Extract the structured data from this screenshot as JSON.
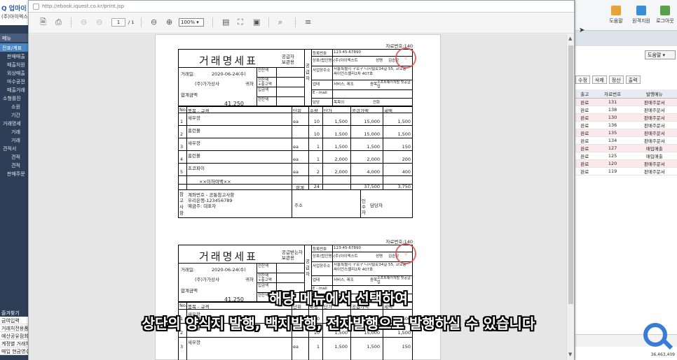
{
  "left_app": {
    "logo": "Q 업마이",
    "company": "(주)아이엑스트",
    "menu_header": "메뉴",
    "section": "전표/계표",
    "items": [
      "판매매출",
      "매출처원",
      "외상매출",
      "마수공전",
      "매출거래",
      "소형를진",
      "소원",
      "기간",
      "거래명세",
      "거래",
      "거래",
      "견적서",
      "견적",
      "견적",
      "판매주문"
    ],
    "bottom_header": "즐겨찾기",
    "bottom_items": [
      "금여입력",
      "거래처전용품목",
      "예산공유점회 설",
      "계정별 거래처",
      "매입 현금영수증"
    ]
  },
  "right_app": {
    "toolbar": [
      {
        "label": "도움말",
        "color": "#e8a23a"
      },
      {
        "label": "원격지원",
        "color": "#3a8ed8"
      },
      {
        "label": "로그아웃",
        "color": "#5aa04a"
      }
    ],
    "help_label": "도움말",
    "actions": [
      "수정",
      "삭제",
      "정산",
      "출력"
    ],
    "columns": [
      "출고",
      "자료번호",
      "발행메뉴"
    ],
    "rows": [
      [
        "완료",
        "131",
        "판매주문서"
      ],
      [
        "완료",
        "138",
        "판매주문서"
      ],
      [
        "완료",
        "130",
        "판매주문서"
      ],
      [
        "완료",
        "136",
        "판매주문서"
      ],
      [
        "완료",
        "135",
        "판매주문서"
      ],
      [
        "완료",
        "134",
        "판매주문서"
      ],
      [
        "완료",
        "127",
        "매입매출"
      ],
      [
        "완료",
        "125",
        "매입매출"
      ],
      [
        "완료",
        "120",
        "판매주문서"
      ],
      [
        "완료",
        "119",
        "판매주문서"
      ]
    ],
    "total": "36,463,409"
  },
  "popup": {
    "url": "http://ebook.iquest.co.kr/print.jsp",
    "page_current": "1",
    "page_total": "/ 1",
    "zoom": "100%"
  },
  "invoice": {
    "doc_no": "자료번호:140",
    "title": "거래명세표",
    "copy_type_1": "공급자",
    "copy_type_2": "보관용",
    "copy_type_b1": "공급받는자",
    "copy_type_b2": "보관용",
    "date_label": "거래일:",
    "date": "2020-06-24(수)",
    "customer": "(주)가가상사",
    "honorific": "귀하",
    "total_label": "합계금액",
    "total_value": "41,250",
    "left_col_labels": [
      "전잔액",
      "전잔액\n+출고액",
      "입금액",
      "현잔액"
    ],
    "supplier_side": "공급자",
    "reg_no_label": "등록번호",
    "reg_no": "123-45-67890",
    "company_label": "상호(법인명)",
    "company_name": "(주)아이엑스트",
    "ceo_label": "성명",
    "ceo_name": "김승모",
    "addr_label": "사업장주소",
    "address": "서울특별시 구로구 디지털로34길 55, 코오롱싸이언스밸리2차 407호",
    "type_label": "업태",
    "type_value": "서비스, 제조",
    "item_label": "종목",
    "item_value": "소프트웨어개발 및공급업",
    "email_label": "E - mail",
    "manager_label": "담당",
    "manager_value": "목목이",
    "phone_label": "전화",
    "seal_text": "인",
    "table_headers": [
      "No.",
      "품목 - 규격",
      "단위",
      "수량",
      "단가",
      "공급가액",
      "세액"
    ],
    "lines": [
      {
        "no": "1",
        "item": "새우깡",
        "unit": "ea",
        "qty": "10",
        "price": "1,500",
        "amount": "15,000",
        "tax": "1,500"
      },
      {
        "no": "2",
        "item": "홈런볼",
        "unit": "",
        "qty": "10",
        "price": "1,500",
        "amount": "15,000",
        "tax": "1,500"
      },
      {
        "no": "3",
        "item": "새우깡",
        "unit": "ea",
        "qty": "1",
        "price": "1,500",
        "amount": "1,500",
        "tax": "150"
      },
      {
        "no": "4",
        "item": "홈런볼",
        "unit": "ea",
        "qty": "1",
        "price": "2,000",
        "amount": "2,000",
        "tax": "200"
      },
      {
        "no": "5",
        "item": "초코파이",
        "unit": "ea",
        "qty": "2",
        "price": "2,000",
        "amount": "4,000",
        "tax": "400"
      }
    ],
    "below_marker": "××이하여백××",
    "sum_label": "합계",
    "sum_qty": "24",
    "sum_amount": "37,500",
    "sum_tax": "3,750",
    "notes_side": "참고사항",
    "notes": [
      "계좌번호 - 공통참고사항",
      "우리은행-123456789",
      "예금주: 대표자"
    ],
    "addr_small": "주소",
    "receiver_side": "인수자",
    "receiver_label": "담당자"
  },
  "subtitle": {
    "line1": "해당 메뉴에서 선택하여",
    "line2": "상단의 양식지 발행, 백지발행, 전자발행으로 발행하실 수 있습니다"
  }
}
